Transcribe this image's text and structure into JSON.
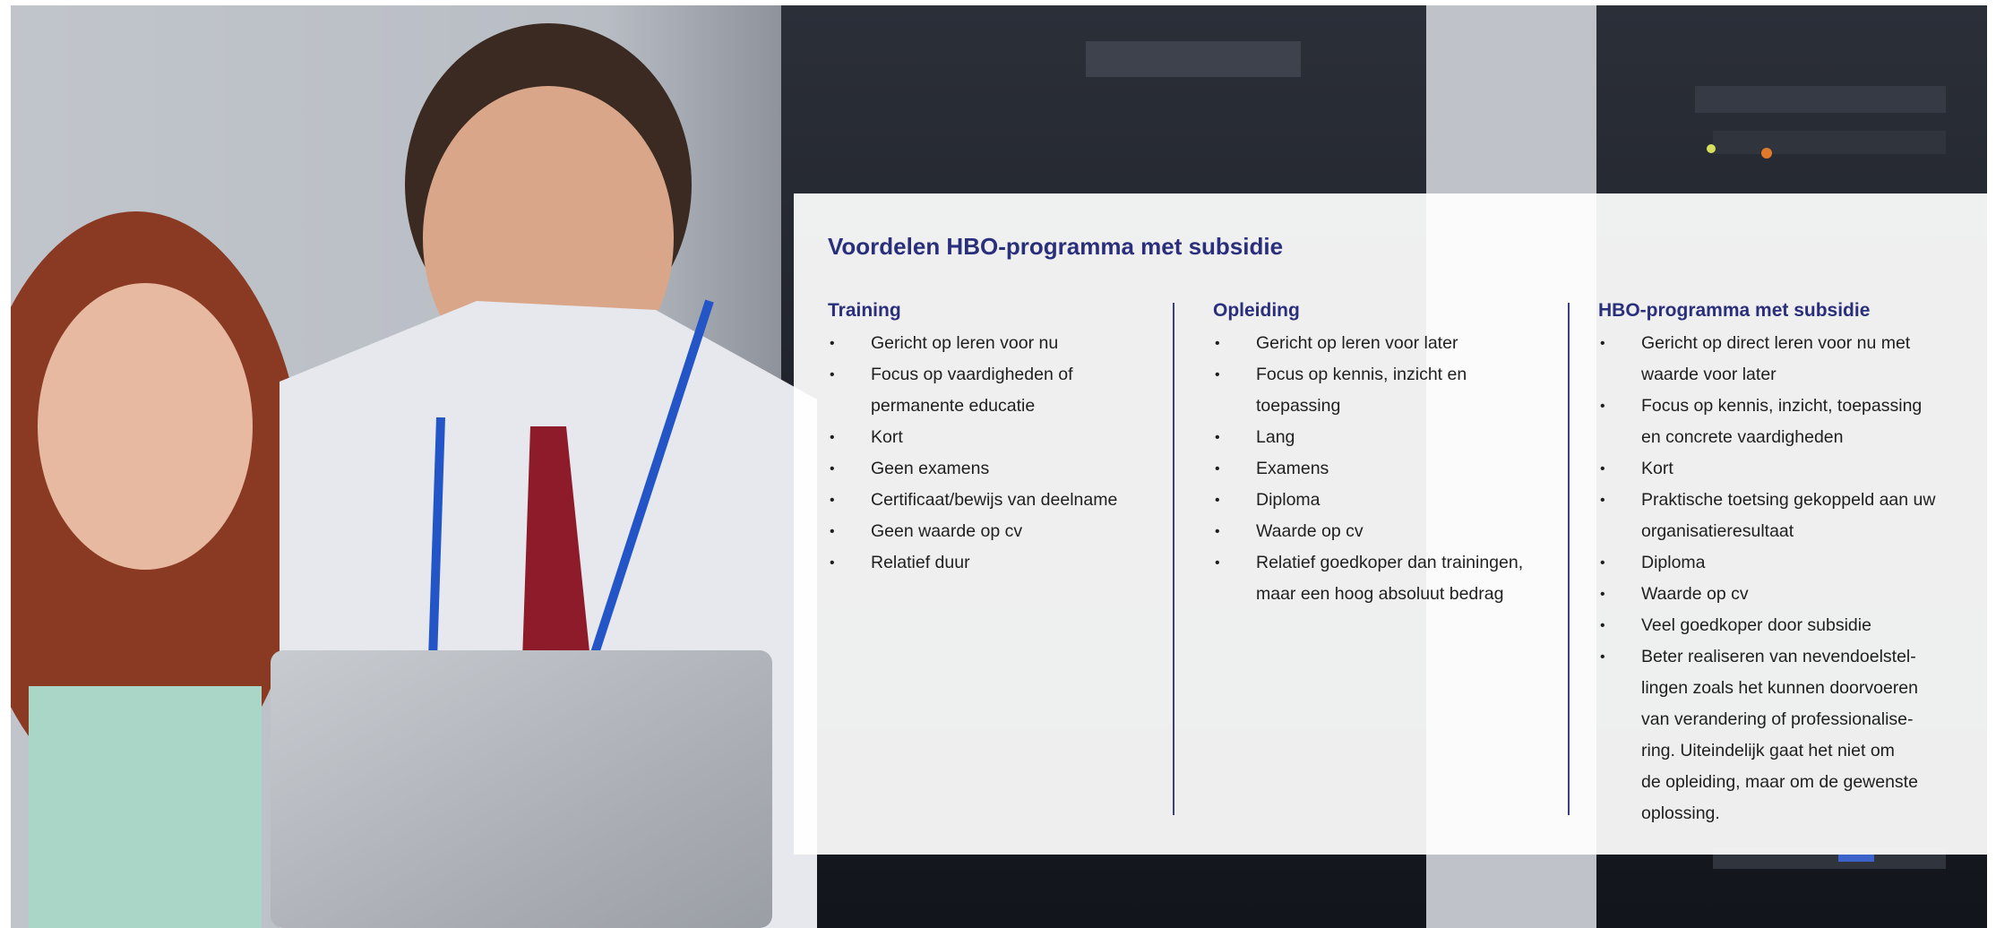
{
  "photo": {
    "description_icon": "photo-two-people-laptop-server-room"
  },
  "panel": {
    "title": "Voordelen HBO-programma met subsidie",
    "columns": [
      {
        "heading": "Training",
        "items": [
          "Gericht op leren voor nu",
          "Focus op vaardigheden of",
          "permanente educatie",
          "Kort",
          "Geen examens",
          "Certificaat/bewijs van deelname",
          "Geen waarde op cv",
          "Relatief duur"
        ],
        "bullets": [
          true,
          true,
          false,
          true,
          true,
          true,
          true,
          true
        ]
      },
      {
        "heading": "Opleiding",
        "items": [
          "Gericht op leren voor later",
          "Focus op kennis, inzicht en",
          "toepassing",
          "Lang",
          "Examens",
          "Diploma",
          "Waarde op cv",
          "Relatief goedkoper dan trainingen,",
          "maar een hoog absoluut bedrag"
        ],
        "bullets": [
          true,
          true,
          false,
          true,
          true,
          true,
          true,
          true,
          false
        ]
      },
      {
        "heading": "HBO-programma met subsidie",
        "items": [
          "Gericht op direct leren voor nu met",
          "waarde voor later",
          "Focus op kennis, inzicht, toepassing",
          "en concrete vaardigheden",
          "Kort",
          "Praktische toetsing gekoppeld aan uw",
          "organisatieresultaat",
          "Diploma",
          "Waarde op cv",
          "Veel goedkoper door subsidie",
          "Beter realiseren van nevendoelstel-",
          "lingen zoals het kunnen doorvoeren",
          "van verandering of professionalise-",
          "ring. Uiteindelijk gaat het niet om",
          "de opleiding, maar om de gewenste",
          "oplossing."
        ],
        "bullets": [
          true,
          false,
          true,
          false,
          true,
          true,
          false,
          true,
          true,
          true,
          true,
          false,
          false,
          false,
          false,
          false
        ]
      }
    ]
  },
  "colors": {
    "accent": "#2a2f7c",
    "divider": "#3b3f86",
    "text": "#1f1f1f"
  }
}
